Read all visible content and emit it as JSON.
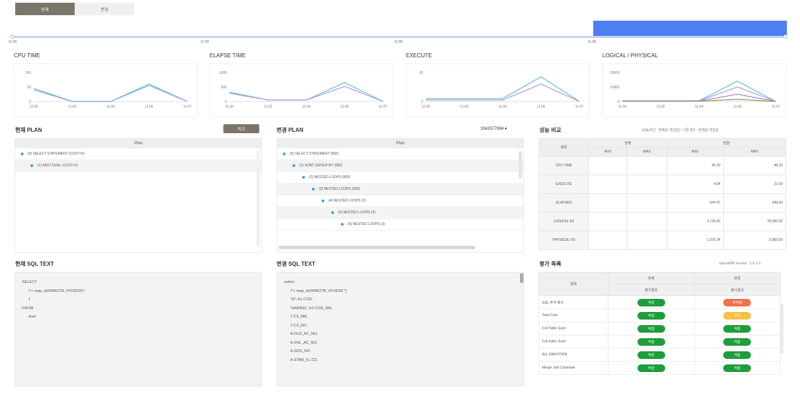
{
  "tabs": [
    {
      "label": "현재"
    },
    {
      "label": "변경"
    }
  ],
  "timeline": {
    "labels": [
      "11:00",
      "11:00",
      "11:00",
      "11:00"
    ]
  },
  "charts": [
    {
      "title": "CPU TIME",
      "yticks": [
        "100",
        "50",
        "0"
      ],
      "xticks": [
        "11:00",
        "11:02",
        "11:04",
        "11:06",
        "11:07"
      ],
      "series": [
        {
          "color": "#5bc0c9",
          "values": [
            45,
            0,
            0,
            60,
            0
          ]
        },
        {
          "color": "#8da4e8",
          "values": [
            40,
            0,
            0,
            55,
            0
          ]
        }
      ],
      "ymax": 100
    },
    {
      "title": "ELAPSE TIME",
      "yticks": [
        "1000",
        "500",
        "0"
      ],
      "xticks": [
        "11:00",
        "11:02",
        "11:04",
        "11:06",
        "11:07"
      ],
      "series": [
        {
          "color": "#5bc0c9",
          "values": [
            320,
            50,
            50,
            650,
            0
          ]
        },
        {
          "color": "#a59ae8",
          "values": [
            280,
            50,
            50,
            520,
            0
          ]
        }
      ],
      "ymax": 1000
    },
    {
      "title": "EXECUTE",
      "yticks": [
        "20",
        "0"
      ],
      "xticks": [
        "11:00",
        "11:02",
        "11:04",
        "11:06",
        "11:07"
      ],
      "series": [
        {
          "color": "#5bc0c9",
          "values": [
            2,
            2,
            2,
            17,
            0
          ]
        },
        {
          "color": "#a59ae8",
          "values": [
            1,
            1,
            1,
            12,
            0
          ]
        }
      ],
      "ymax": 20
    },
    {
      "title": "LOGICAL / PHYSICAL",
      "yticks": [
        "20000",
        "10000",
        "0"
      ],
      "xticks": [
        "11:00",
        "11:02",
        "11:04",
        "11:06",
        "11:07"
      ],
      "series": [
        {
          "color": "#5bc0c9",
          "values": [
            500,
            500,
            500,
            14000,
            0
          ]
        },
        {
          "color": "#a59ae8",
          "values": [
            400,
            400,
            400,
            10000,
            0
          ]
        },
        {
          "color": "#9a8fd0",
          "values": [
            300,
            300,
            300,
            5000,
            0
          ]
        },
        {
          "color": "#8a9a5a",
          "values": [
            200,
            200,
            200,
            1500,
            0
          ]
        }
      ],
      "ymax": 20000
    }
  ],
  "current_plan": {
    "title": "현재 PLAN",
    "button": "비교",
    "header": "Plan",
    "rows": [
      "(0) SELECT STATEMENT (COST=2)",
      "(1) FAST DUAL (COST=2)"
    ]
  },
  "change_plan": {
    "title": "변경 PLAN",
    "select": "3342577884 ▾",
    "header": "Plan",
    "rows": [
      "(0) SELECT STATEMENT (583)",
      "(1) SORT GROUP BY (583)",
      "(2) NESTED LOOPS (583)",
      "(3) NESTED LOOPS (583)",
      "(4) NESTED LOOPS (3)",
      "(5) NESTED LOOPS (3)",
      "(6) NESTED LOOPS (3)"
    ]
  },
  "perf": {
    "title": "성능 비교",
    "legend": "(성능개선 : 현재값-개선값) / 기존개선 : 현재값-개선값",
    "col_item": "항목",
    "col_now": "현재",
    "col_change": "변경",
    "sub": [
      "AVG",
      "MAX",
      "AVG",
      "MAX"
    ],
    "rows": [
      {
        "label": "CPU TIME",
        "v": [
          "",
          "",
          "46.29",
          "46.29"
        ]
      },
      {
        "label": "EXECUTE",
        "v": [
          "",
          "",
          "4.04",
          "21.00"
        ]
      },
      {
        "label": "ELAPSED",
        "v": [
          "",
          "",
          "544.47",
          "648.00"
        ]
      },
      {
        "label": "LOGICAL I/O",
        "v": [
          "",
          "",
          "4,725.82",
          "25,992.00"
        ]
      },
      {
        "label": "PHYSICAL I/O",
        "v": [
          "",
          "",
          "1,276.34",
          "5,860.00"
        ]
      }
    ]
  },
  "current_sql": {
    "title": "현재 SQL TEXT",
    "text": "SELECT\n      /*+ map_id(DRBOTB_VFOD03)*/\n      1\nFROM\n      dual"
  },
  "change_sql": {
    "title": "변경 SQL TEXT",
    "text": "select\n      /*+ map_id(DRBOTB_VFOD03 *)\n      'ID', A1.COD,\n      'NAMING', A1.COD_NM,\n      T.CS_NM,\n      T.CS_NO,\n      A.OLD_AC_NO,\n      A.SNL_AC_NO,\n      A.GDS_NO,\n      A.STAR_FL.CD,"
  },
  "eval": {
    "title": "평가 목록",
    "version": "specialDR version : 1.0.1.0",
    "col_item": "항목",
    "col_now": "현재",
    "col_change": "변경",
    "sub_now": "평가결과",
    "sub_change": "평가결과",
    "rows": [
      {
        "label": "SQL 주석 체크",
        "now": "적합",
        "now_color": "green",
        "change": "부적합",
        "change_color": "red"
      },
      {
        "label": "Total Cost",
        "now": "적합",
        "now_color": "green",
        "change": "주의",
        "change_color": "yellow"
      },
      {
        "label": "Full Table Scan",
        "now": "적합",
        "now_color": "green",
        "change": "적합",
        "change_color": "green"
      },
      {
        "label": "Full Index Scan",
        "now": "적합",
        "now_color": "green",
        "change": "적합",
        "change_color": "green"
      },
      {
        "label": "ALL PARTITION",
        "now": "적합",
        "now_color": "green",
        "change": "적합",
        "change_color": "green"
      },
      {
        "label": "Merge Join Cartesian",
        "now": "적합",
        "now_color": "green",
        "change": "적합",
        "change_color": "green"
      }
    ]
  }
}
